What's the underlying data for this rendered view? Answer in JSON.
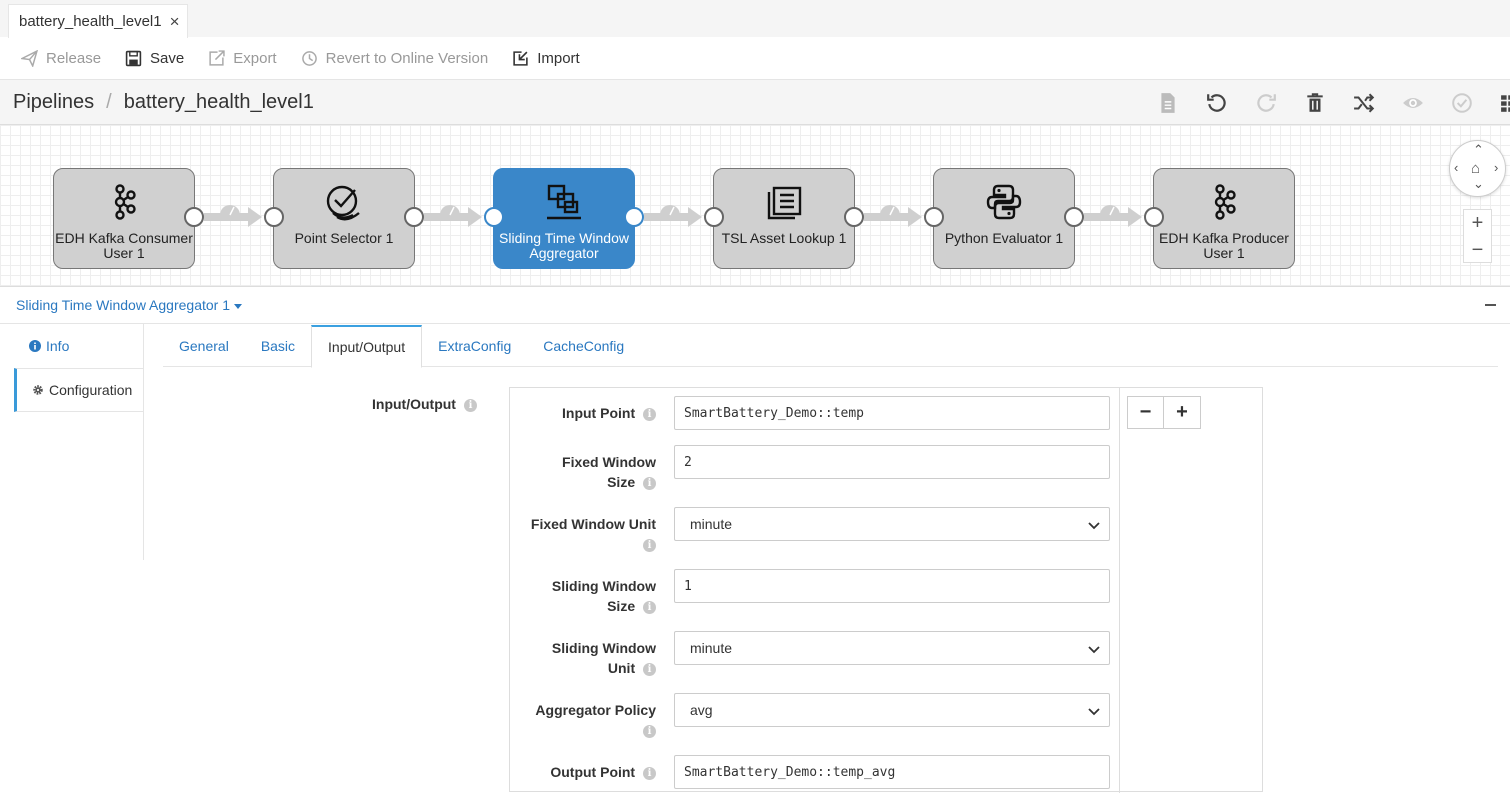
{
  "doc_tab": {
    "title": "battery_health_level1",
    "close": "×"
  },
  "toolbar": {
    "release": "Release",
    "save": "Save",
    "export": "Export",
    "revert": "Revert to Online Version",
    "import": "Import"
  },
  "breadcrumb": {
    "root": "Pipelines",
    "separator": "/",
    "current": "battery_health_level1"
  },
  "crumb_actions": [
    "doc-icon",
    "undo-icon",
    "redo-icon",
    "trash-icon",
    "shuffle-icon",
    "eye-icon",
    "check-circle-icon",
    "grid-icon"
  ],
  "pipeline": {
    "nodes": [
      {
        "label": "EDH Kafka Consumer User 1",
        "icon": "kafka-icon",
        "active": false
      },
      {
        "label": "Point Selector 1",
        "icon": "checklist-icon",
        "active": false
      },
      {
        "label": "Sliding Time Window Aggregator",
        "icon": "window-icon",
        "active": true
      },
      {
        "label": "TSL Asset Lookup 1",
        "icon": "lookup-icon",
        "active": false
      },
      {
        "label": "Python Evaluator 1",
        "icon": "python-icon",
        "active": false
      },
      {
        "label": "EDH Kafka Producer User 1",
        "icon": "kafka-icon",
        "active": false
      }
    ],
    "zoom_in": "+",
    "zoom_out": "−"
  },
  "panel": {
    "title": "Sliding Time Window Aggregator 1"
  },
  "side_tabs": {
    "info": "Info",
    "configuration": "Configuration"
  },
  "tabs": {
    "general": "General",
    "basic": "Basic",
    "input_output": "Input/Output",
    "extra_config": "ExtraConfig",
    "cache_config": "CacheConfig"
  },
  "form": {
    "section_label": "Input/Output",
    "input_point": {
      "label": "Input Point",
      "value": "SmartBattery_Demo::temp"
    },
    "fixed_window_size": {
      "label_1": "Fixed Window",
      "label_2": "Size",
      "value": "2"
    },
    "fixed_window_unit": {
      "label": "Fixed Window Unit",
      "value": "minute"
    },
    "sliding_window_size": {
      "label_1": "Sliding Window",
      "label_2": "Size",
      "value": "1"
    },
    "sliding_window_unit": {
      "label_1": "Sliding Window",
      "label_2": "Unit",
      "value": "minute"
    },
    "aggregator_policy": {
      "label": "Aggregator Policy",
      "value": "avg"
    },
    "output_point": {
      "label": "Output Point",
      "value": "SmartBattery_Demo::temp_avg"
    },
    "remove_row": "−",
    "add_row": "+"
  },
  "colors": {
    "accent": "#3a87c9",
    "link": "#2a78c0",
    "node_gray": "#d0d0d0"
  }
}
